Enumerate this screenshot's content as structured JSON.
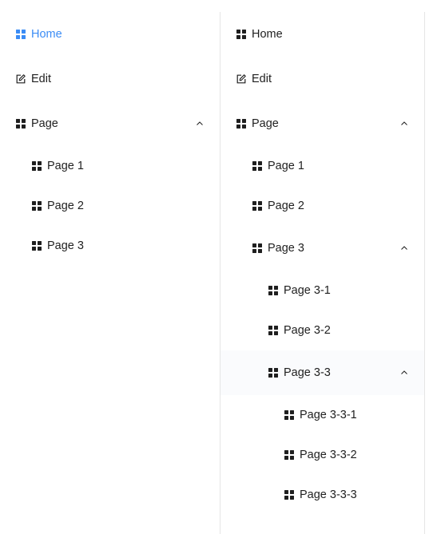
{
  "colors": {
    "active": "#3b8cf5",
    "text": "#1f1f1f",
    "divider": "#e5e5e5"
  },
  "left_menu": {
    "items": [
      {
        "label": "Home",
        "icon": "grid-icon"
      },
      {
        "label": "Edit",
        "icon": "edit-icon"
      },
      {
        "label": "Page",
        "icon": "grid-icon"
      },
      {
        "label": "Page 1",
        "icon": "grid-icon"
      },
      {
        "label": "Page 2",
        "icon": "grid-icon"
      },
      {
        "label": "Page 3",
        "icon": "grid-icon"
      }
    ]
  },
  "right_menu": {
    "items": [
      {
        "label": "Home",
        "icon": "grid-icon"
      },
      {
        "label": "Edit",
        "icon": "edit-icon"
      },
      {
        "label": "Page",
        "icon": "grid-icon"
      },
      {
        "label": "Page 1",
        "icon": "grid-icon"
      },
      {
        "label": "Page 2",
        "icon": "grid-icon"
      },
      {
        "label": "Page 3",
        "icon": "grid-icon"
      },
      {
        "label": "Page 3-1",
        "icon": "grid-icon"
      },
      {
        "label": "Page 3-2",
        "icon": "grid-icon"
      },
      {
        "label": "Page 3-3",
        "icon": "grid-icon"
      },
      {
        "label": "Page 3-3-1",
        "icon": "grid-icon"
      },
      {
        "label": "Page 3-3-2",
        "icon": "grid-icon"
      },
      {
        "label": "Page 3-3-3",
        "icon": "grid-icon"
      }
    ]
  }
}
